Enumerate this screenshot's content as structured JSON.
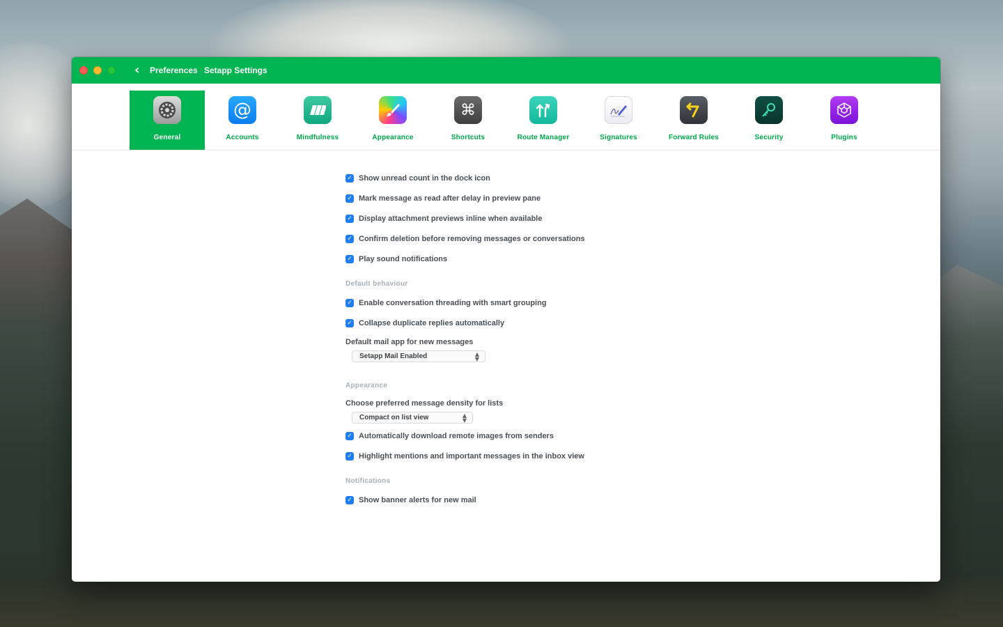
{
  "window": {
    "crumbs": [
      "Preferences",
      "Setapp Settings"
    ]
  },
  "toolbar": {
    "items": [
      {
        "label": "General",
        "icon": "gear-icon",
        "active": true
      },
      {
        "label": "Accounts",
        "icon": "at-sign-icon"
      },
      {
        "label": "Mindfulness",
        "icon": "stacked-bars-icon"
      },
      {
        "label": "Appearance",
        "icon": "paintbrush-icon"
      },
      {
        "label": "Shortcuts",
        "icon": "command-key-icon"
      },
      {
        "label": "Route  Manager",
        "icon": "split-arrows-icon"
      },
      {
        "label": "Signatures",
        "icon": "signature-icon"
      },
      {
        "label": "Forward  Rules",
        "icon": "return-arrow-icon"
      },
      {
        "label": "Security",
        "icon": "key-icon"
      },
      {
        "label": "Plugins",
        "icon": "cube-icon"
      }
    ]
  },
  "settings": {
    "group1": [
      "Show unread count in the dock icon",
      "Mark message as read after delay in preview pane",
      "Display attachment previews inline when available",
      "Confirm deletion before removing messages or conversations",
      "Play sound notifications"
    ],
    "group2_head": "Default behaviour",
    "group2": [
      "Enable conversation threading with smart grouping",
      "Collapse duplicate replies automatically"
    ],
    "group2_line": "Default mail app for new messages",
    "group2_select": "Setapp Mail Enabled",
    "group3_head": "Appearance",
    "group3_line": "Choose preferred message density for lists",
    "group3_select": "Compact on list view",
    "group3": [
      "Automatically download remote images from senders",
      "Highlight mentions and important messages in the inbox view"
    ],
    "group4_head": "Notifications",
    "group4": [
      "Show banner alerts for new mail"
    ]
  }
}
